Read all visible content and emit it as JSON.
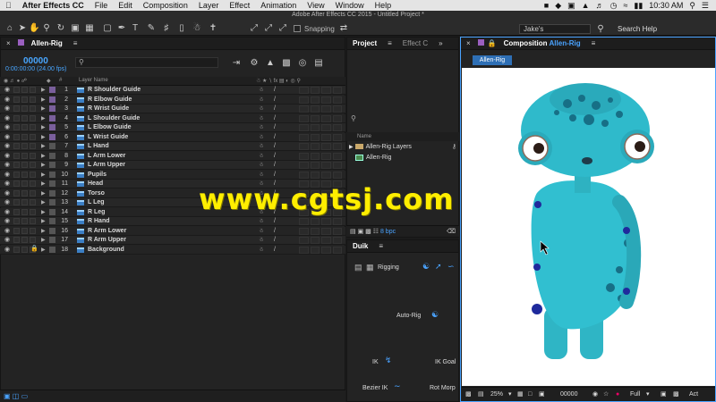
{
  "menubar": {
    "app": "After Effects CC",
    "items": [
      "File",
      "Edit",
      "Composition",
      "Layer",
      "Effect",
      "Animation",
      "View",
      "Window",
      "Help"
    ],
    "time": "10:30 AM"
  },
  "window_title": "Adobe After Effects CC 2015 - Untitled Project *",
  "toolbar": {
    "snapping_label": "Snapping",
    "workspace": "Jake's",
    "search_help": "Search Help"
  },
  "timeline": {
    "tab": "Allen-Rig",
    "timecode": "00000",
    "timecode_sub": "0:00:00:00 (24.00 fps)",
    "column_layer_name": "Layer Name",
    "layers": [
      {
        "num": "1",
        "name": "R Shoulder Guide",
        "color": "#7a5f9c"
      },
      {
        "num": "2",
        "name": "R Elbow Guide",
        "color": "#7a5f9c"
      },
      {
        "num": "3",
        "name": "R Wrist Guide",
        "color": "#7a5f9c"
      },
      {
        "num": "4",
        "name": "L Shoulder Guide",
        "color": "#7a5f9c"
      },
      {
        "num": "5",
        "name": "L Elbow Guide",
        "color": "#7a5f9c"
      },
      {
        "num": "6",
        "name": "L Wrist Guide",
        "color": "#7a5f9c"
      },
      {
        "num": "7",
        "name": "L Hand",
        "color": "#555555"
      },
      {
        "num": "8",
        "name": "L Arm Lower",
        "color": "#555555"
      },
      {
        "num": "9",
        "name": "L Arm Upper",
        "color": "#555555"
      },
      {
        "num": "10",
        "name": "Pupils",
        "color": "#555555"
      },
      {
        "num": "11",
        "name": "Head",
        "color": "#555555"
      },
      {
        "num": "12",
        "name": "Torso",
        "color": "#555555"
      },
      {
        "num": "13",
        "name": "L Leg",
        "color": "#555555"
      },
      {
        "num": "14",
        "name": "R Leg",
        "color": "#555555"
      },
      {
        "num": "15",
        "name": "R Hand",
        "color": "#555555"
      },
      {
        "num": "16",
        "name": "R Arm Lower",
        "color": "#555555"
      },
      {
        "num": "17",
        "name": "R Arm Upper",
        "color": "#555555"
      },
      {
        "num": "18",
        "name": "Background",
        "color": "#555555"
      }
    ]
  },
  "project": {
    "tab": "Project",
    "tab2": "Effect C",
    "column_name": "Name",
    "items": [
      "Allen-Rig Layers",
      "Allen-Rig"
    ],
    "bpc": "8 bpc"
  },
  "duik": {
    "tab": "Duik",
    "rigging": "Rigging",
    "auto_rig": "Auto-Rig",
    "ik": "IK",
    "ik_goal": "IK Goal",
    "bezier_ik": "Bezier IK",
    "rot_morph": "Rot Morp"
  },
  "composition": {
    "tab_prefix": "Composition",
    "tab_name": "Allen-Rig",
    "chip": "Allen-Rig",
    "zoom": "25%",
    "timecode": "00000",
    "resolution": "Full",
    "trailing": "Act"
  },
  "watermark": "www.cgtsj.com"
}
